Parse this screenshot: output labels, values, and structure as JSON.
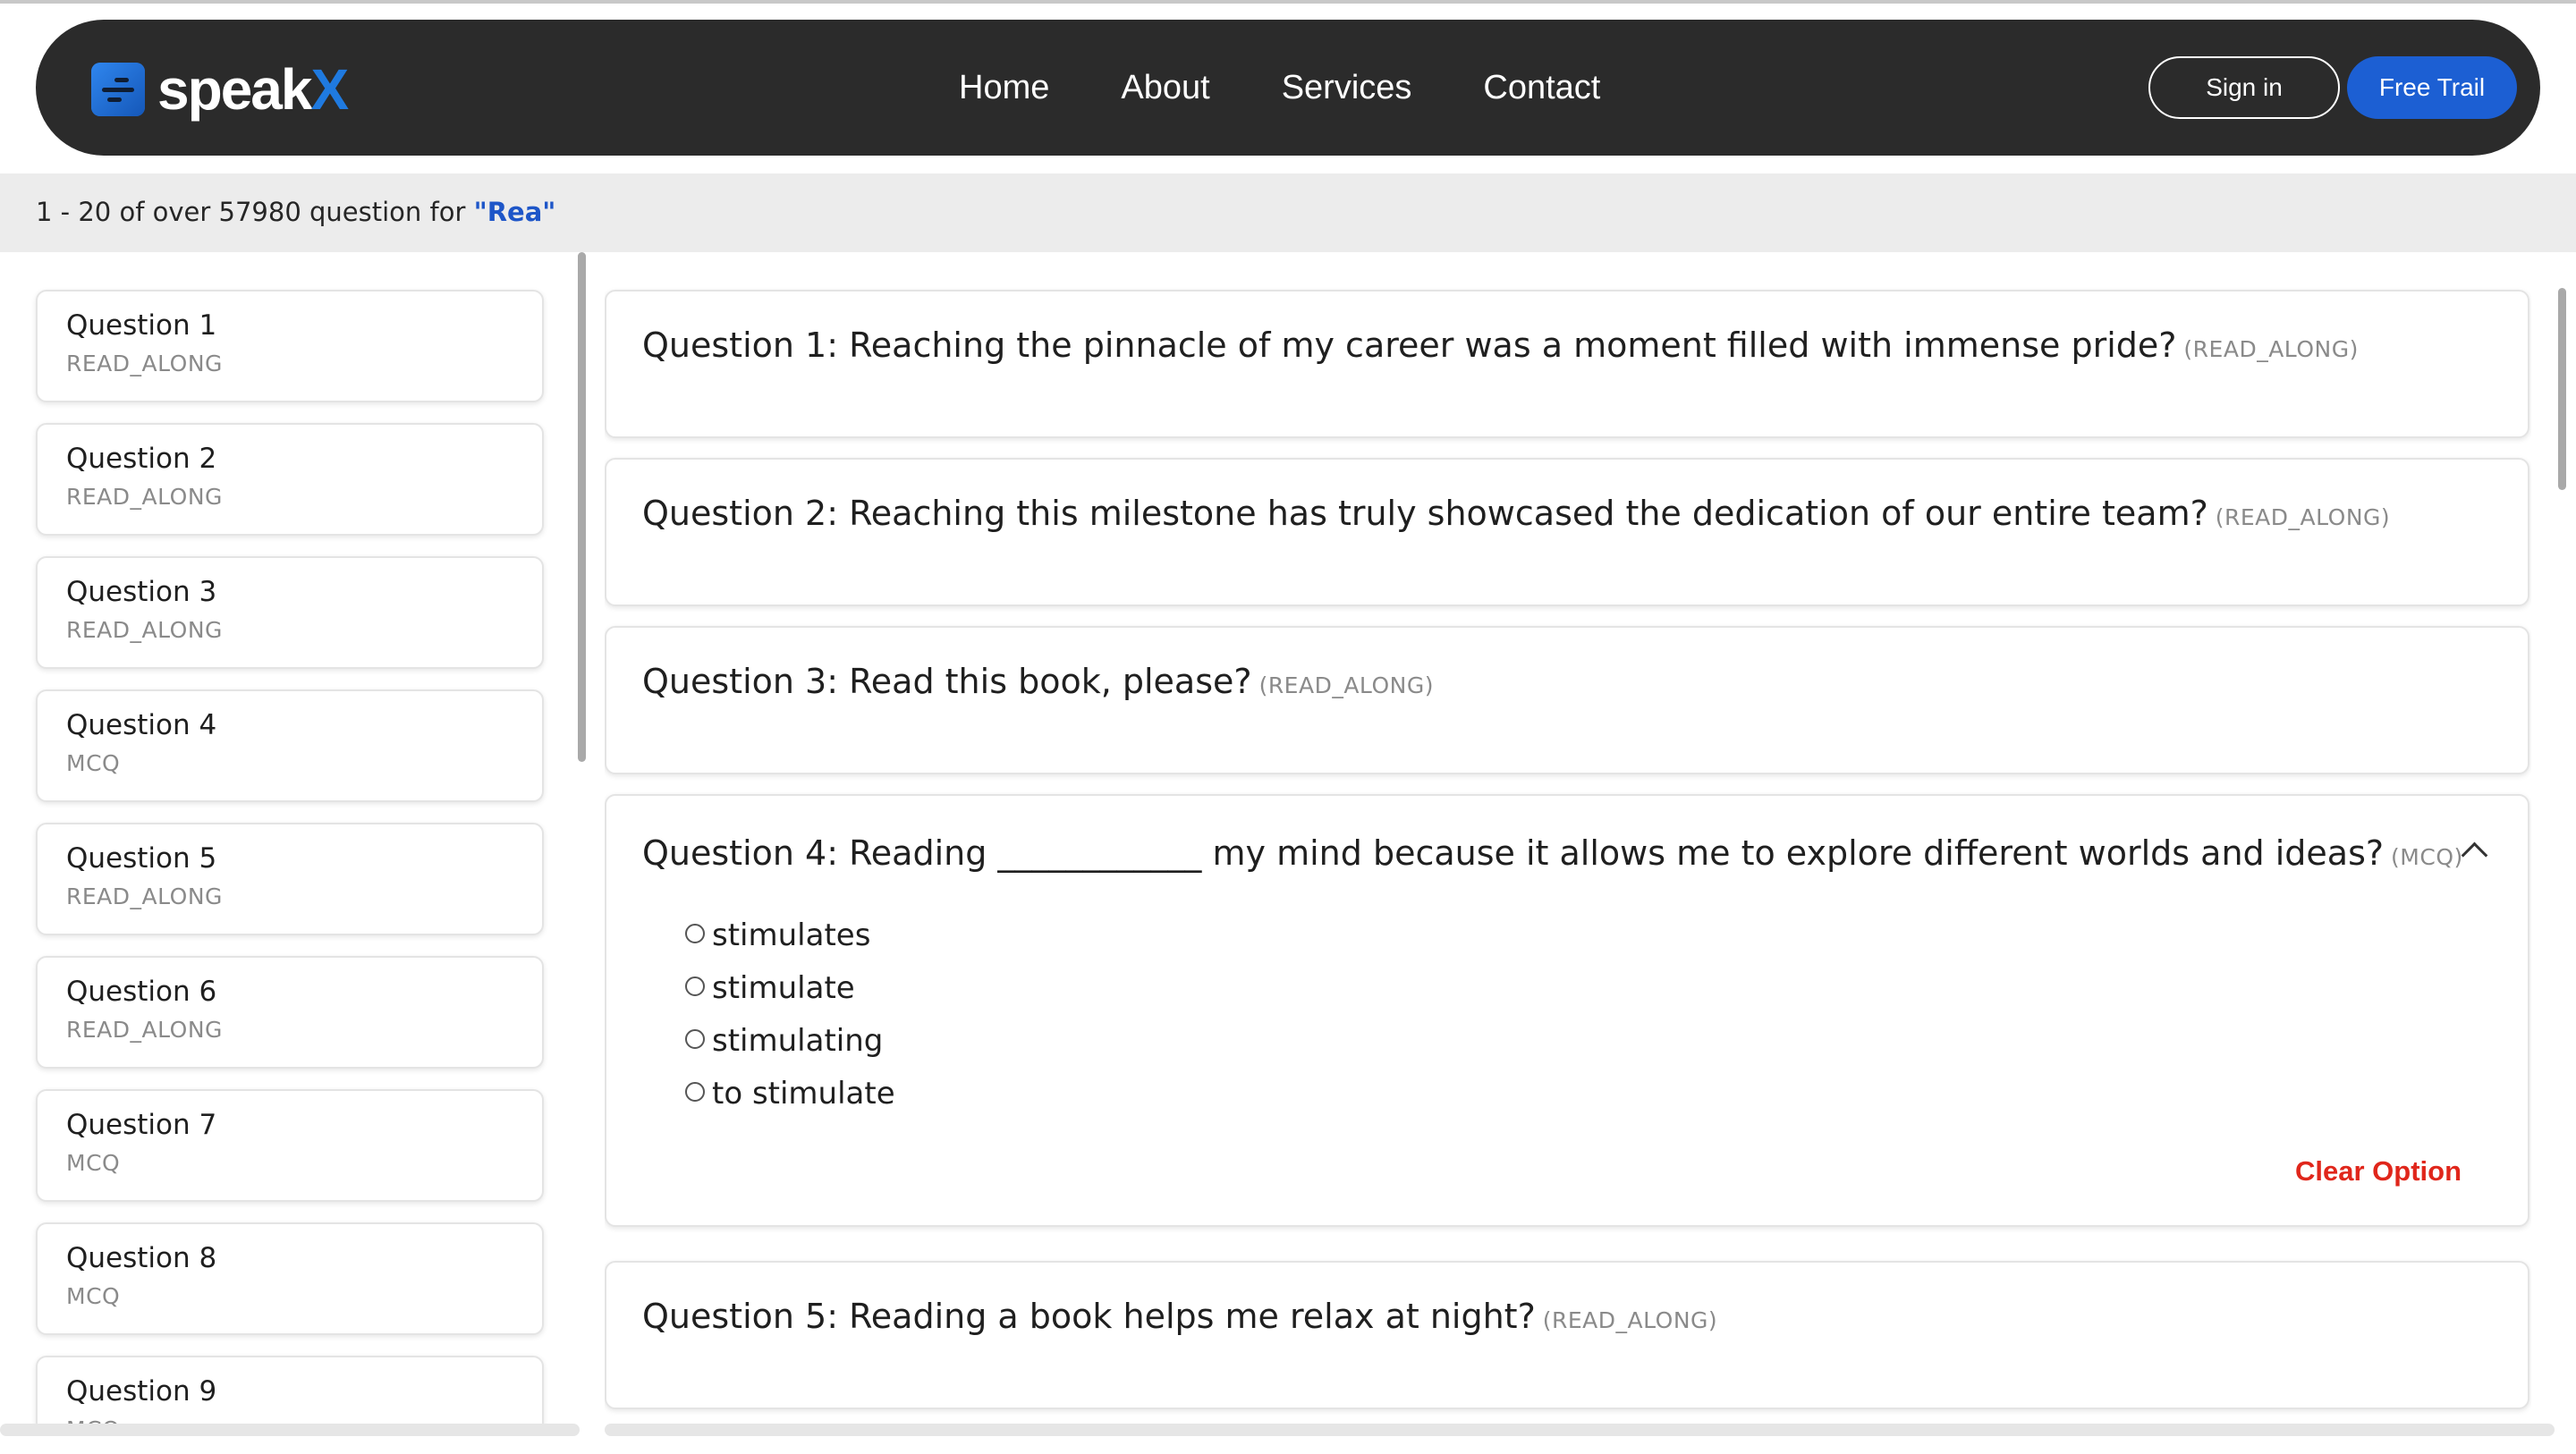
{
  "header": {
    "brand_text": "speak",
    "brand_x": "X",
    "nav": [
      "Home",
      "About",
      "Services",
      "Contact"
    ],
    "signin_label": "Sign in",
    "trial_label": "Free Trail"
  },
  "results": {
    "prefix": "1 - 20 of over 57980 question for ",
    "query": "\"Rea\""
  },
  "sidebar": {
    "items": [
      {
        "title": "Question 1",
        "type": "READ_ALONG"
      },
      {
        "title": "Question 2",
        "type": "READ_ALONG"
      },
      {
        "title": "Question 3",
        "type": "READ_ALONG"
      },
      {
        "title": "Question 4",
        "type": "MCQ"
      },
      {
        "title": "Question 5",
        "type": "READ_ALONG"
      },
      {
        "title": "Question 6",
        "type": "READ_ALONG"
      },
      {
        "title": "Question 7",
        "type": "MCQ"
      },
      {
        "title": "Question 8",
        "type": "MCQ"
      },
      {
        "title": "Question 9",
        "type": "MCQ"
      }
    ]
  },
  "questions": [
    {
      "text": "Question 1: Reaching the pinnacle of my career was a moment filled with immense pride?",
      "type": "(READ_ALONG)"
    },
    {
      "text": "Question 2: Reaching this milestone has truly showcased the dedication of our entire team?",
      "type": "(READ_ALONG)"
    },
    {
      "text": "Question 3: Read this book, please?",
      "type": "(READ_ALONG)"
    },
    {
      "text": "Question 4: Reading ____________ my mind because it allows me to explore different worlds and ideas?",
      "type": "(MCQ)",
      "options": [
        "stimulates",
        "stimulate",
        "stimulating",
        "to stimulate"
      ],
      "clear_label": "Clear Option"
    },
    {
      "text": "Question 5: Reading a book helps me relax at night?",
      "type": "(READ_ALONG)"
    }
  ],
  "colors": {
    "header_bg": "#2b2b2b",
    "brand_blue": "#1f7ae0",
    "primary_button": "#1c5fd3",
    "query_highlight": "#1e56c8",
    "clear_option": "#e0261b"
  },
  "icons": [
    "speakx-logo-icon",
    "chevron-up-icon",
    "radio-icon"
  ]
}
